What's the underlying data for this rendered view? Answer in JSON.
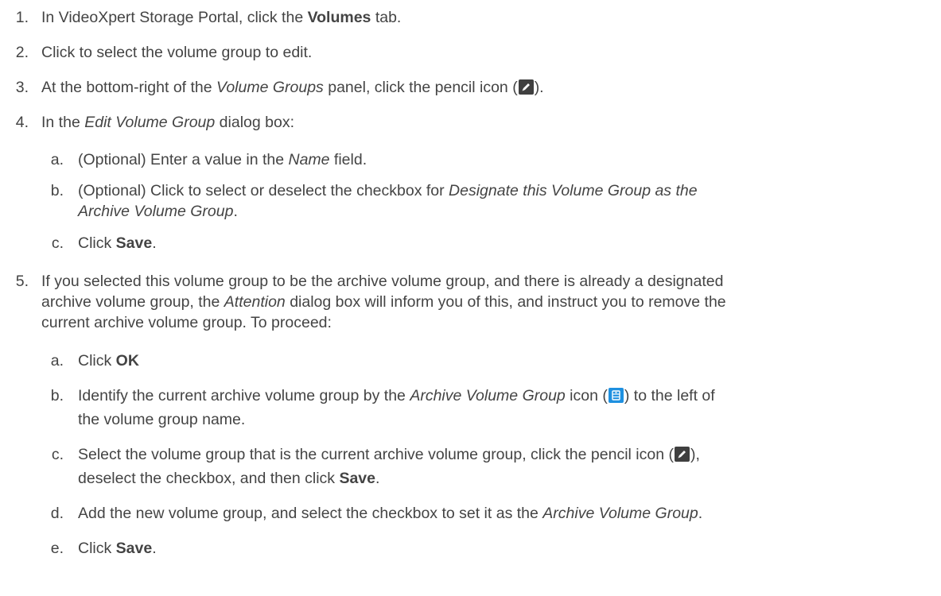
{
  "steps": [
    {
      "num": "1.",
      "parts": {
        "a": "In VideoXpert Storage Portal, click the ",
        "b": "Volumes",
        "c": " tab."
      }
    },
    {
      "num": "2.",
      "parts": {
        "a": "Click to select the volume group to edit."
      }
    },
    {
      "num": "3.",
      "parts": {
        "a": "At the bottom-right of the ",
        "b": "Volume Groups",
        "c": " panel, click the pencil icon (",
        "d": ")."
      }
    },
    {
      "num": "4.",
      "parts": {
        "a": "In the ",
        "b": "Edit Volume Group",
        "c": " dialog box:"
      },
      "sub": [
        {
          "num": "a.",
          "a": "(Optional) Enter a value in the ",
          "b": "Name",
          "c": " field."
        },
        {
          "num": "b.",
          "a": "(Optional) Click to select or deselect the checkbox for ",
          "b": "Designate this Volume Group as the",
          "line2": "Archive Volume Group",
          "c": "."
        },
        {
          "num": "c.",
          "a": "Click ",
          "b": "Save",
          "c": "."
        }
      ]
    },
    {
      "num": "5.",
      "lines": [
        "If you selected this volume group to be the archive volume group, and there is already a designated",
        "archive volume group, the ",
        "Attention",
        " dialog box will inform you of this, and instruct you to remove the",
        "current archive volume group. To proceed:"
      ],
      "sub": [
        {
          "num": "a.",
          "a": "Click ",
          "b": "OK"
        },
        {
          "num": "b.",
          "a": "Identify the current archive volume group by the ",
          "b": "Archive Volume Group",
          "c": " icon (",
          "d": ") to the left of",
          "line2": "the volume group name."
        },
        {
          "num": "c.",
          "a": "Select the volume group that is the current archive volume group, click the pencil icon (",
          "d": "),",
          "line2": "deselect the checkbox, and then click ",
          "b": "Save",
          "e": "."
        },
        {
          "num": "d.",
          "a": "Add the new volume group, and select the checkbox to set it as the ",
          "b": "Archive Volume Group",
          "c": "."
        },
        {
          "num": "e.",
          "a": "Click ",
          "b": "Save",
          "c": "."
        }
      ]
    }
  ],
  "icons": {
    "pencil": "pencil-icon",
    "archive": "archive-volume-group-icon",
    "pencil_bg": "#3f3f3f",
    "archive_bg": "#1e90e0"
  }
}
